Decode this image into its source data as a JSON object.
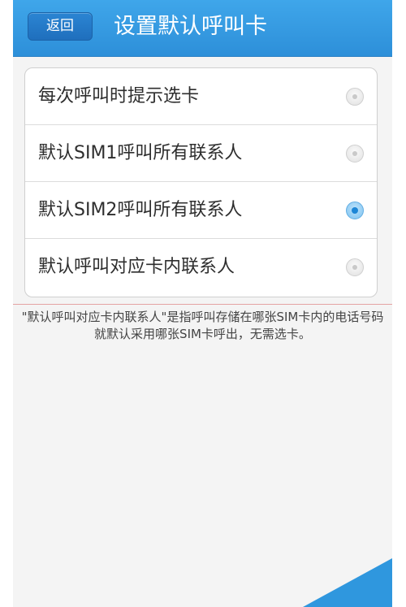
{
  "header": {
    "back_label": "返回",
    "title": "设置默认呼叫卡"
  },
  "options": [
    {
      "label": "每次呼叫时提示选卡",
      "selected": false
    },
    {
      "label": "默认SIM1呼叫所有联系人",
      "selected": false
    },
    {
      "label": "默认SIM2呼叫所有联系人",
      "selected": true
    },
    {
      "label": "默认呼叫对应卡内联系人",
      "selected": false
    }
  ],
  "description": "\"默认呼叫对应卡内联系人\"是指呼叫存储在哪张SIM卡内的电话号码就默认采用哪张SIM卡呼出，无需选卡。",
  "colors": {
    "accent": "#2d8fd9",
    "radio_selected": "#1d86d6"
  }
}
